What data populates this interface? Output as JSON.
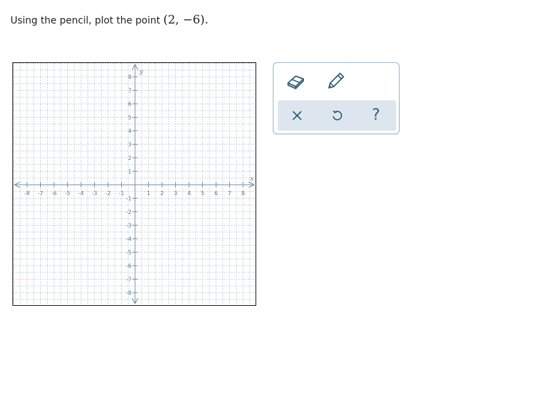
{
  "prompt": {
    "text": "Using the pencil, plot the point",
    "point": "(2, −6)",
    "end": "."
  },
  "graph": {
    "x_range": [
      -8,
      8
    ],
    "y_range": [
      -8,
      8
    ],
    "x_axis_label": "x",
    "y_axis_label": "y",
    "x_tick_labels": [
      "-8",
      "-7",
      "-6",
      "-5",
      "-4",
      "-3",
      "-2",
      "-1",
      "1",
      "2",
      "3",
      "4",
      "5",
      "6",
      "7",
      "8"
    ],
    "y_tick_labels": [
      "8",
      "7",
      "6",
      "5",
      "4",
      "3",
      "2",
      "1",
      "-1",
      "-2",
      "-3",
      "-4",
      "-5",
      "-6",
      "-7",
      "-8"
    ],
    "grid": "dotted, minor step 0.5",
    "colors": {
      "axis": "#6f8fa3",
      "grid": "#b9c4cc",
      "tick_label": "#5e7a8c"
    }
  },
  "toolbar": {
    "tools": [
      {
        "name": "eraser",
        "icon": "eraser-icon"
      },
      {
        "name": "pencil",
        "icon": "pencil-icon"
      }
    ],
    "actions": [
      {
        "name": "clear",
        "icon": "close-icon"
      },
      {
        "name": "undo",
        "icon": "undo-icon"
      },
      {
        "name": "help",
        "icon": "help-icon",
        "label": "?"
      }
    ],
    "colors": {
      "icon": "#2f5d73",
      "border": "#9fb4c7",
      "action_bar": "#dde6ee"
    }
  }
}
